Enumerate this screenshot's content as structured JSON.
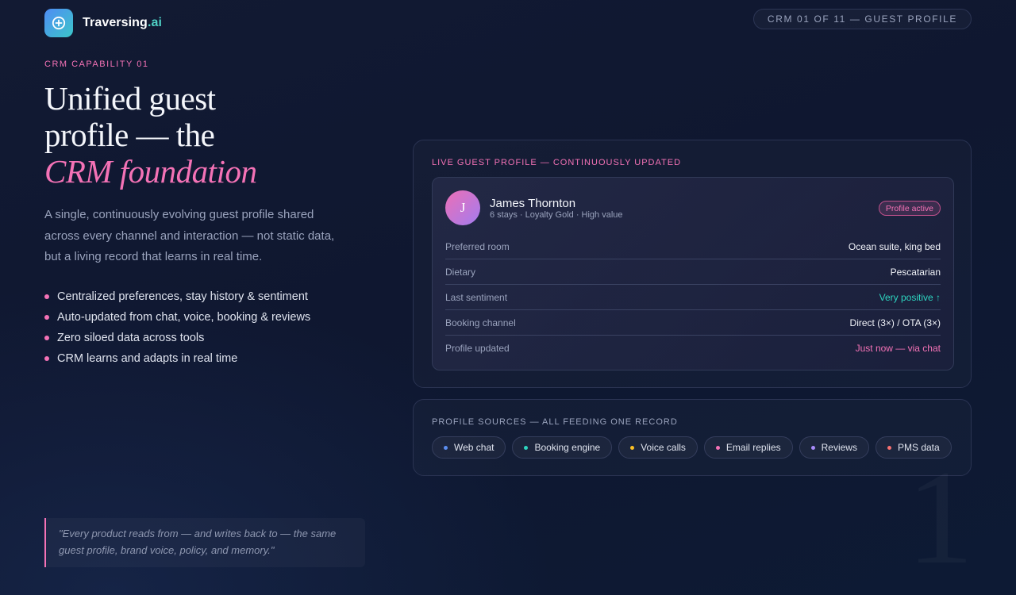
{
  "brand": {
    "name": "Traversing",
    "suffix": ".ai"
  },
  "pager": {
    "label": "CRM 01 OF 11 — GUEST PROFILE"
  },
  "hero": {
    "eyebrow": "CRM CAPABILITY 01",
    "headline_line1": "Unified guest",
    "headline_line2": "profile — the",
    "headline_accent": "CRM foundation",
    "lede": "A single, continuously evolving guest profile shared across every channel and interaction — not static data, but a living record that learns in real time.",
    "bullets": [
      "Centralized preferences, stay history & sentiment",
      "Auto-updated from chat, voice, booking & reviews",
      "Zero siloed data across tools",
      "CRM learns and adapts in real time"
    ],
    "quote": "\"Every product reads from — and writes back to — the same guest profile, brand voice, policy, and memory.\""
  },
  "profile_card": {
    "title": "LIVE GUEST PROFILE — CONTINUOUSLY UPDATED",
    "avatar_initial": "J",
    "guest_name": "James Thornton",
    "guest_meta": "6 stays · Loyalty Gold · High value",
    "badge": "Profile active",
    "rows": [
      {
        "label": "Preferred room",
        "value": "Ocean suite, king bed"
      },
      {
        "label": "Dietary",
        "value": "Pescatarian"
      },
      {
        "label": "Last sentiment",
        "value": "Very positive ↑"
      },
      {
        "label": "Booking channel",
        "value": "Direct (3×) / OTA (3×)"
      },
      {
        "label": "Profile updated",
        "value": "Just now — via chat"
      }
    ]
  },
  "sources_card": {
    "title": "PROFILE SOURCES — ALL FEEDING ONE RECORD",
    "chips": [
      {
        "label": "Web chat",
        "color": "#5b8def"
      },
      {
        "label": "Booking engine",
        "color": "#2dd4bf"
      },
      {
        "label": "Voice calls",
        "color": "#fbbf24"
      },
      {
        "label": "Email replies",
        "color": "#f472b6"
      },
      {
        "label": "Reviews",
        "color": "#a78bfa"
      },
      {
        "label": "PMS data",
        "color": "#f87171"
      }
    ]
  },
  "watermark_number": "1",
  "colors": {
    "accent": "#f472b6",
    "positive": "#2dd4bf",
    "background": "#111a33"
  }
}
